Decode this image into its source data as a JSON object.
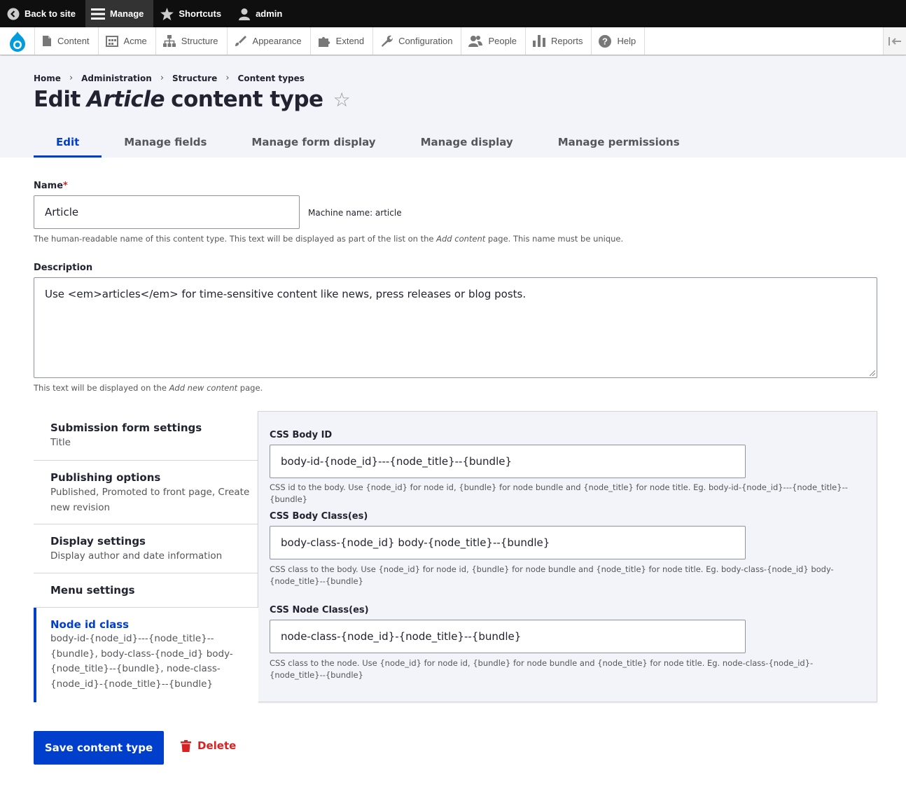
{
  "toolbar": {
    "back_to_site": "Back to site",
    "manage": "Manage",
    "shortcuts": "Shortcuts",
    "user": "admin"
  },
  "tray": {
    "items": [
      "Content",
      "Acme",
      "Structure",
      "Appearance",
      "Extend",
      "Configuration",
      "People",
      "Reports",
      "Help"
    ]
  },
  "breadcrumb": [
    "Home",
    "Administration",
    "Structure",
    "Content types"
  ],
  "title": {
    "prefix": "Edit",
    "emphasis": "Article",
    "suffix": "content type"
  },
  "tabs": [
    "Edit",
    "Manage fields",
    "Manage form display",
    "Manage display",
    "Manage permissions"
  ],
  "form": {
    "name_label": "Name",
    "required_mark": "*",
    "name_value": "Article",
    "machine_name": "Machine name: article",
    "name_desc_1": "The human-readable name of this content type. This text will be displayed as part of the list on the ",
    "name_desc_em": "Add content",
    "name_desc_2": " page. This name must be unique.",
    "description_label": "Description",
    "description_value": "Use <em>articles</em> for time-sensitive content like news, press releases or blog posts.",
    "description_desc_1": "This text will be displayed on the ",
    "description_desc_em": "Add new content",
    "description_desc_2": " page."
  },
  "vertical_tabs": [
    {
      "title": "Submission form settings",
      "summary": "Title"
    },
    {
      "title": "Publishing options",
      "summary": "Published, Promoted to front page, Create new revision"
    },
    {
      "title": "Display settings",
      "summary": "Display author and date information"
    },
    {
      "title": "Menu settings",
      "summary": ""
    },
    {
      "title": "Node id class",
      "summary": "body-id-{node_id}---{node_title}--{bundle}, body-class-{node_id} body-{node_title}--{bundle}, node-class-{node_id}-{node_title}--{bundle}"
    }
  ],
  "pane": {
    "body_id_label": "CSS Body ID",
    "body_id_value": "body-id-{node_id}---{node_title}--{bundle}",
    "body_id_desc": "CSS id to the body. Use {node_id} for node id, {bundle} for node bundle and {node_title} for node title. Eg. body-id-{node_id}---{node_title}--{bundle}",
    "body_class_label": "CSS Body Class(es)",
    "body_class_value": "body-class-{node_id} body-{node_title}--{bundle}",
    "body_class_desc": "CSS class to the body. Use {node_id} for node id, {bundle} for node bundle and {node_title} for node title. Eg. body-class-{node_id} body-{node_title}--{bundle}",
    "node_class_label": "CSS Node Class(es)",
    "node_class_value": "node-class-{node_id}-{node_title}--{bundle}",
    "node_class_desc": "CSS class to the node. Use {node_id} for node id, {bundle} for node bundle and {node_title} for node title. Eg. node-class-{node_id}-{node_title}--{bundle}"
  },
  "actions": {
    "save": "Save content type",
    "delete": "Delete"
  },
  "colors": {
    "primary": "#003ecc",
    "danger": "#d72222",
    "toolbar_bg": "#0f0f0f",
    "header_bg": "#f3f4f9"
  }
}
